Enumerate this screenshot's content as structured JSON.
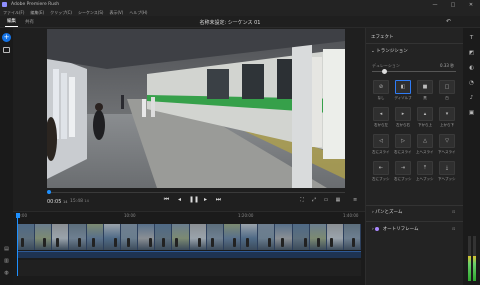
{
  "window": {
    "title": "Adobe Premiere Rush",
    "controls": [
      "—",
      "□",
      "✕"
    ]
  },
  "menu": [
    "ファイル(F)",
    "編集(E)",
    "クリップ(C)",
    "シーケンス(S)",
    "表示(V)",
    "ヘルプ(H)"
  ],
  "topbar": {
    "tabs": [
      {
        "label": "編集",
        "active": true
      },
      {
        "label": "共有",
        "active": false
      }
    ],
    "sequence_title": "名称未設定: シーケンス 01"
  },
  "monitor": {
    "timecode": "00:05",
    "timecode_frames": "14",
    "duration": "15:48",
    "duration_frames": "14",
    "transport": [
      "skip-to-start-icon",
      "step-back-icon",
      "play-icon",
      "step-forward-icon",
      "skip-to-end-icon"
    ],
    "tools": [
      "crop-icon",
      "fullscreen-icon",
      "aspect-icon",
      "settings-icon"
    ]
  },
  "timeline": {
    "ruler": [
      "0:00",
      "10:00",
      "1:20:00",
      "1:40:00"
    ],
    "clip_count": 20,
    "playhead_pos": 0
  },
  "effects_panel": {
    "title": "エフェクト",
    "transitions_header": "トランジション",
    "duration_label": "デュレーション",
    "duration_value": "0.33 秒",
    "duration_fraction": 0.15,
    "transitions": [
      {
        "label": "なし",
        "icon": "none-icon",
        "glyph": "⊘",
        "selected": false
      },
      {
        "label": "ディゾルブ",
        "icon": "dissolve-icon",
        "glyph": "◧",
        "selected": true
      },
      {
        "label": "黒",
        "icon": "dip-black-icon",
        "glyph": "■",
        "selected": false
      },
      {
        "label": "白",
        "icon": "dip-white-icon",
        "glyph": "□",
        "selected": false
      },
      {
        "label": "右から左",
        "icon": "push-left-icon",
        "glyph": "◂",
        "selected": false
      },
      {
        "label": "左から右",
        "icon": "push-right-icon",
        "glyph": "▸",
        "selected": false
      },
      {
        "label": "下から上",
        "icon": "push-up-icon",
        "glyph": "▴",
        "selected": false
      },
      {
        "label": "上から下",
        "icon": "push-down-icon",
        "glyph": "▾",
        "selected": false
      },
      {
        "label": "左にスライド",
        "icon": "slide-left-icon",
        "glyph": "◁",
        "selected": false
      },
      {
        "label": "右にスライド",
        "icon": "slide-right-icon",
        "glyph": "▷",
        "selected": false
      },
      {
        "label": "上へスライド",
        "icon": "slide-up-icon",
        "glyph": "△",
        "selected": false
      },
      {
        "label": "下へスライド",
        "icon": "slide-down-icon",
        "glyph": "▽",
        "selected": false
      },
      {
        "label": "左にプッシュ",
        "icon": "wipe-left-icon",
        "glyph": "⇤",
        "selected": false
      },
      {
        "label": "右にプッシュ",
        "icon": "wipe-right-icon",
        "glyph": "⇥",
        "selected": false
      },
      {
        "label": "上へプッシュ",
        "icon": "wipe-up-icon",
        "glyph": "⤒",
        "selected": false
      },
      {
        "label": "下へプッシュ",
        "icon": "wipe-down-icon",
        "glyph": "⤓",
        "selected": false
      }
    ],
    "sections": [
      {
        "label": "パンとズーム",
        "right": "⊡"
      },
      {
        "label": "オートリフレーム",
        "right": "⊡"
      }
    ]
  },
  "right_iconbar": [
    "titles-icon",
    "transitions-icon",
    "color-icon",
    "speed-icon",
    "audio-icon",
    "transform-icon"
  ],
  "audio_meter": {
    "left_level": 0.55,
    "right_level": 0.55
  },
  "colors": {
    "accent": "#1473e6",
    "playhead": "#1e90ff",
    "selected": "#2f7cf6"
  }
}
